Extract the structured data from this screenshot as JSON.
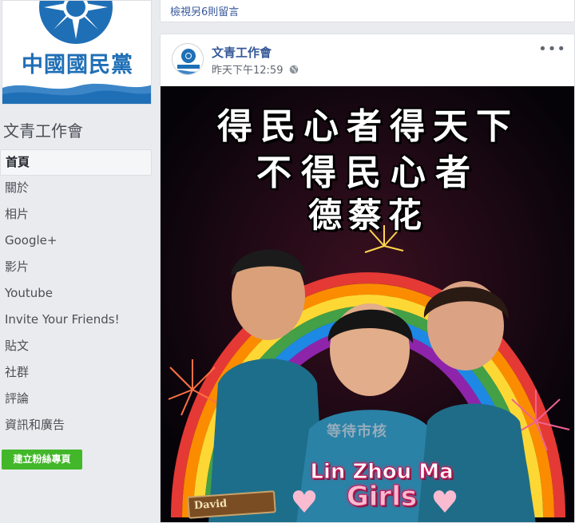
{
  "sidebar": {
    "cover_text": "中國國民黨",
    "page_name": "文青工作會",
    "nav": [
      {
        "label": "首頁",
        "active": true
      },
      {
        "label": "關於",
        "active": false
      },
      {
        "label": "相片",
        "active": false
      },
      {
        "label": "Google+",
        "active": false
      },
      {
        "label": "影片",
        "active": false
      },
      {
        "label": "Youtube",
        "active": false
      },
      {
        "label": "Invite Your Friends!",
        "active": false
      },
      {
        "label": "貼文",
        "active": false
      },
      {
        "label": "社群",
        "active": false
      },
      {
        "label": "評論",
        "active": false
      },
      {
        "label": "資訊和廣告",
        "active": false
      }
    ],
    "create_page_button": "建立粉絲專頁"
  },
  "top_strip": {
    "view_more_comments": "檢視另6則留言"
  },
  "post": {
    "author": "文青工作會",
    "time": "昨天下午12:59",
    "privacy_icon": "globe-icon",
    "more_icon": "more-horizontal-icon",
    "more_text": "•••",
    "image": {
      "caption_line1": "得民心者得天下",
      "caption_line2": "不得民心者",
      "caption_line3": "德蔡花",
      "stamp_text": "等待市核",
      "logo_line1": "Lin Zhou Ma",
      "logo_line2": "Girls",
      "sign_text": "David"
    }
  },
  "colors": {
    "link": "#365899",
    "create_button": "#42b72a",
    "kmt_blue": "#1f6fb6",
    "page_bg": "#e9ebee"
  }
}
